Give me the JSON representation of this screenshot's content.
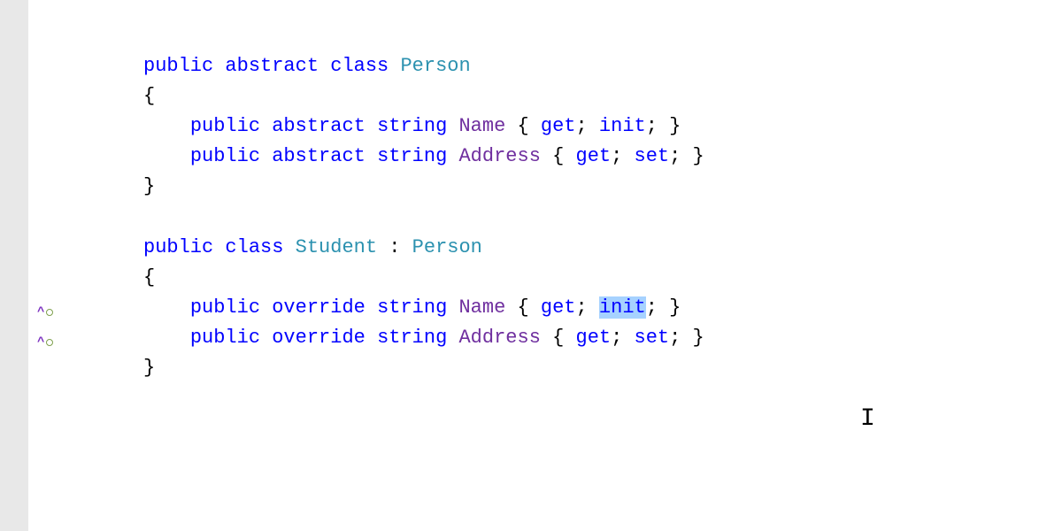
{
  "code": {
    "kw_public": "public",
    "kw_abstract": "abstract",
    "kw_class": "class",
    "kw_override": "override",
    "kw_string": "string",
    "kw_get": "get",
    "kw_set": "set",
    "kw_init": "init",
    "class_person": "Person",
    "class_student": "Student",
    "prop_name": "Name",
    "prop_address": "Address",
    "brace_open": "{",
    "brace_close": "}",
    "semi": ";",
    "colon": ":"
  },
  "indicators": [
    {
      "line": 10
    },
    {
      "line": 11
    }
  ]
}
